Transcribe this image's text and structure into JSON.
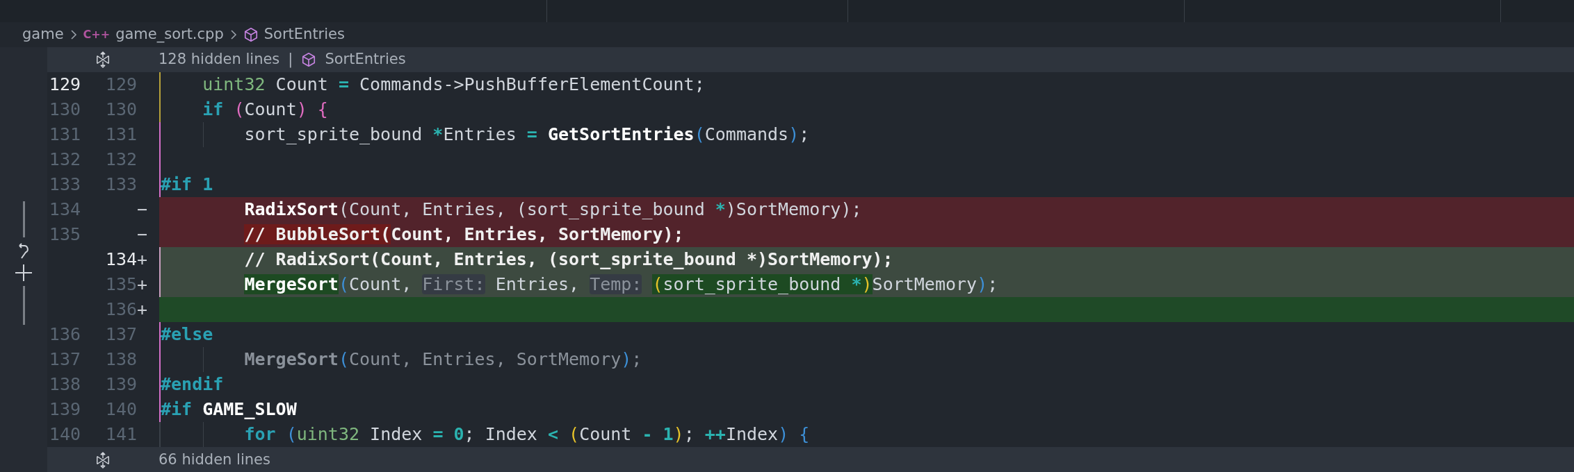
{
  "breadcrumb": {
    "folder": "game",
    "file_badge": "C++",
    "file": "game_sort.cpp",
    "symbol": "SortEntries"
  },
  "top_fold": {
    "label": "128 hidden lines",
    "separator": "|",
    "symbol": "SortEntries"
  },
  "rows": [
    {
      "kind": "context",
      "old": "129",
      "new": "129",
      "current": true,
      "color": "#b8a23a",
      "segments": [
        {
          "text": "    uint32",
          "kind": "type"
        },
        {
          "text": " Count ",
          "kind": "plain"
        },
        {
          "text": "=",
          "kind": "op"
        },
        {
          "text": " Commands->PushBufferElementCount;",
          "kind": "plain"
        }
      ]
    },
    {
      "kind": "context",
      "old": "130",
      "new": "130",
      "current": false,
      "color": "#b8a23a",
      "segments": [
        {
          "text": "    if ",
          "kind": "keyword"
        },
        {
          "text": "(",
          "kind": "paren2"
        },
        {
          "text": "Count",
          "kind": "plain"
        },
        {
          "text": ") {",
          "kind": "paren2"
        }
      ]
    },
    {
      "kind": "context",
      "old": "131",
      "new": "131",
      "current": false,
      "color": "#d46fc8",
      "segments": [
        {
          "text": "        sort_sprite_bound ",
          "kind": "plain"
        },
        {
          "text": "*",
          "kind": "op"
        },
        {
          "text": "Entries ",
          "kind": "plain"
        },
        {
          "text": "= ",
          "kind": "op"
        },
        {
          "text": "GetSortEntries",
          "kind": "func"
        },
        {
          "text": "(",
          "kind": "paren1"
        },
        {
          "text": "Commands",
          "kind": "plain"
        },
        {
          "text": ")",
          "kind": "paren1"
        },
        {
          "text": ";",
          "kind": "plain"
        }
      ]
    },
    {
      "kind": "context",
      "old": "132",
      "new": "132",
      "current": false,
      "color": "#d46fc8",
      "segments": []
    },
    {
      "kind": "context",
      "old": "133",
      "new": "133",
      "current": false,
      "color": "#d46fc8",
      "segments": [
        {
          "text": "#if 1",
          "kind": "preproc"
        }
      ]
    },
    {
      "kind": "deleted",
      "old": "134",
      "marker": "−",
      "current": false,
      "segments": [
        {
          "text": "        RadixSort",
          "kind": "func"
        },
        {
          "text": "(Count, Entries, (sort_sprite_bound ",
          "kind": "plain"
        },
        {
          "text": "*",
          "kind": "op"
        },
        {
          "text": ")SortMemory);",
          "kind": "plain"
        }
      ]
    },
    {
      "kind": "deleted",
      "old": "135",
      "marker": "−",
      "current": false,
      "segments": [
        {
          "text": "        // BubbleSort(",
          "kind": "comment_hl_del"
        },
        {
          "text": "Count, Entries, SortMemory);",
          "kind": "comment"
        }
      ]
    },
    {
      "kind": "added",
      "new": "134",
      "marker": "+",
      "current": true,
      "color": "#c9a0c0",
      "segments": [
        {
          "text": "        // RadixSort(Count, Entries, (sort_sprite_bound *)SortMemory);",
          "kind": "comment"
        }
      ]
    },
    {
      "kind": "added",
      "new": "135",
      "marker": "+",
      "current": false,
      "color": "#c9a0c0",
      "segments": [
        {
          "text": "        MergeSort",
          "kind": "func_hl"
        },
        {
          "text": "(",
          "kind": "paren1"
        },
        {
          "text": "Count, ",
          "kind": "plain"
        },
        {
          "text": "First:",
          "kind": "hint"
        },
        {
          "text": " Entries, ",
          "kind": "plain"
        },
        {
          "text": "Temp:",
          "kind": "hint"
        },
        {
          "text": " (",
          "kind": "paren3_hl"
        },
        {
          "text": "sort_sprite_bound ",
          "kind": "plain_hl"
        },
        {
          "text": "*",
          "kind": "op_hl"
        },
        {
          "text": ")",
          "kind": "paren3_hl"
        },
        {
          "text": "SortMemory",
          "kind": "plain"
        },
        {
          "text": ")",
          "kind": "paren1"
        },
        {
          "text": ";",
          "kind": "plain"
        }
      ]
    },
    {
      "kind": "added_strong",
      "new": "136",
      "marker": "+",
      "current": false,
      "segments": []
    },
    {
      "kind": "context",
      "old": "136",
      "new": "137",
      "current": false,
      "color": "#d46fc8",
      "segments": [
        {
          "text": "#else",
          "kind": "preproc"
        }
      ]
    },
    {
      "kind": "context",
      "old": "137",
      "new": "138",
      "current": false,
      "color": "#d46fc8",
      "segments": [
        {
          "text": "        MergeSort",
          "kind": "dim_bold"
        },
        {
          "text": "(",
          "kind": "paren1"
        },
        {
          "text": "Count, Entries, SortMemory",
          "kind": "dim"
        },
        {
          "text": ")",
          "kind": "paren1"
        },
        {
          "text": ";",
          "kind": "dim"
        }
      ]
    },
    {
      "kind": "context",
      "old": "138",
      "new": "139",
      "current": false,
      "color": "#d46fc8",
      "segments": [
        {
          "text": "#endif",
          "kind": "preproc"
        }
      ]
    },
    {
      "kind": "context",
      "old": "139",
      "new": "140",
      "current": false,
      "color": "#d46fc8",
      "segments": [
        {
          "text": "#if ",
          "kind": "preproc"
        },
        {
          "text": "GAME_SLOW",
          "kind": "bold"
        }
      ]
    },
    {
      "kind": "context",
      "old": "140",
      "new": "141",
      "current": false,
      "color": "#3a4048",
      "segments": [
        {
          "text": "        for ",
          "kind": "keyword"
        },
        {
          "text": "(",
          "kind": "paren1"
        },
        {
          "text": "uint32",
          "kind": "type"
        },
        {
          "text": " Index ",
          "kind": "plain"
        },
        {
          "text": "= 0",
          "kind": "op"
        },
        {
          "text": "; Index ",
          "kind": "plain"
        },
        {
          "text": "< ",
          "kind": "op"
        },
        {
          "text": "(",
          "kind": "paren3"
        },
        {
          "text": "Count ",
          "kind": "plain"
        },
        {
          "text": "- 1",
          "kind": "op"
        },
        {
          "text": ")",
          "kind": "paren3"
        },
        {
          "text": "; ",
          "kind": "plain"
        },
        {
          "text": "++",
          "kind": "op"
        },
        {
          "text": "Index",
          "kind": "plain"
        },
        {
          "text": ") {",
          "kind": "paren1"
        }
      ]
    }
  ],
  "bottom_fold": {
    "label": "66 hidden lines"
  }
}
